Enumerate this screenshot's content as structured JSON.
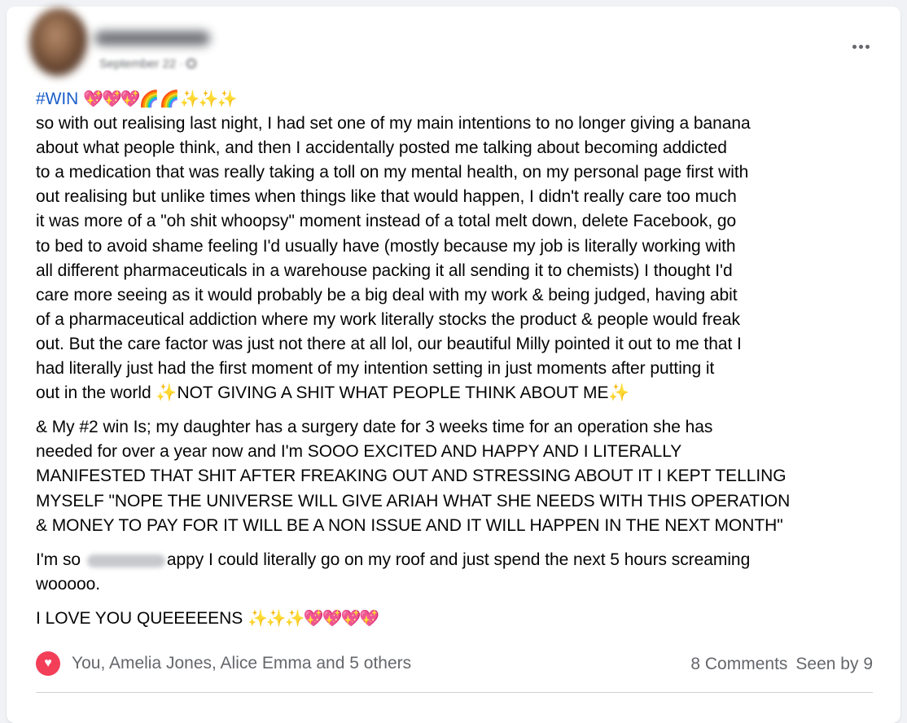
{
  "post": {
    "hashtag": "#WIN",
    "intro_emoji": {
      "hearts": "💖💖💖",
      "rainbows": "🌈🌈",
      "sparkles": "✨✨✨"
    },
    "para1": "so with out realising last night, I had set one of my main intentions to no longer giving a banana\nabout what people think, and then I accidentally posted me talking about becoming addicted\nto a medication that was really taking a toll on my mental health, on my personal page first with\nout realising but unlike times when things like that would happen, I didn't really care too much\nit was more of a \"oh shit whoopsy\" moment instead of a total melt down, delete Facebook, go\nto bed to avoid shame feeling I'd usually have (mostly because my job is literally working with\nall different pharmaceuticals in a warehouse packing it all sending it to chemists) I thought I'd\ncare more seeing as it would probably be a big deal with my work & being judged, having abit\nof a pharmaceutical addiction where my work literally stocks the product & people would freak\nout. But the care factor was just not there at all lol, our beautiful Milly pointed it out to me that I\nhad literally just had the first moment of my intention setting in just moments after putting it\nout in the world ",
    "para1_highlight": "✨NOT GIVING A SHIT WHAT PEOPLE THINK ABOUT ME✨",
    "para2": "& My #2 win Is; my daughter has a surgery date for 3 weeks time for an operation she has\nneeded for over a year now and I'm SOOO EXCITED AND HAPPY AND I LITERALLY\nMANIFESTED THAT SHIT AFTER FREAKING OUT AND STRESSING ABOUT IT I KEPT TELLING\nMYSELF \"NOPE THE UNIVERSE WILL GIVE ARIAH WHAT SHE NEEDS WITH THIS OPERATION\n& MONEY TO PAY FOR IT WILL BE A NON ISSUE AND IT WILL HAPPEN IN THE NEXT MONTH\"",
    "para3_start": "I'm so",
    "para3_end": "appy I could literally go on my roof and just spend the next 5 hours screaming\nwooooo.",
    "para4": "I LOVE YOU QUEEEEENS ",
    "para4_emoji": "✨✨✨💖💖💖💖"
  },
  "header": {
    "date": "September 22 ·"
  },
  "footer": {
    "reactors": "You, Amelia Jones, Alice Emma and 5 others",
    "comments": "8 Comments",
    "seen": "Seen by 9"
  },
  "colors": {
    "hashtag": "#1b5fc9",
    "love_reaction": "#f33e58",
    "meta_text": "#65676b"
  },
  "icons": {
    "reaction": "heart-icon",
    "more": "more-options-icon",
    "privacy": "globe-icon"
  }
}
